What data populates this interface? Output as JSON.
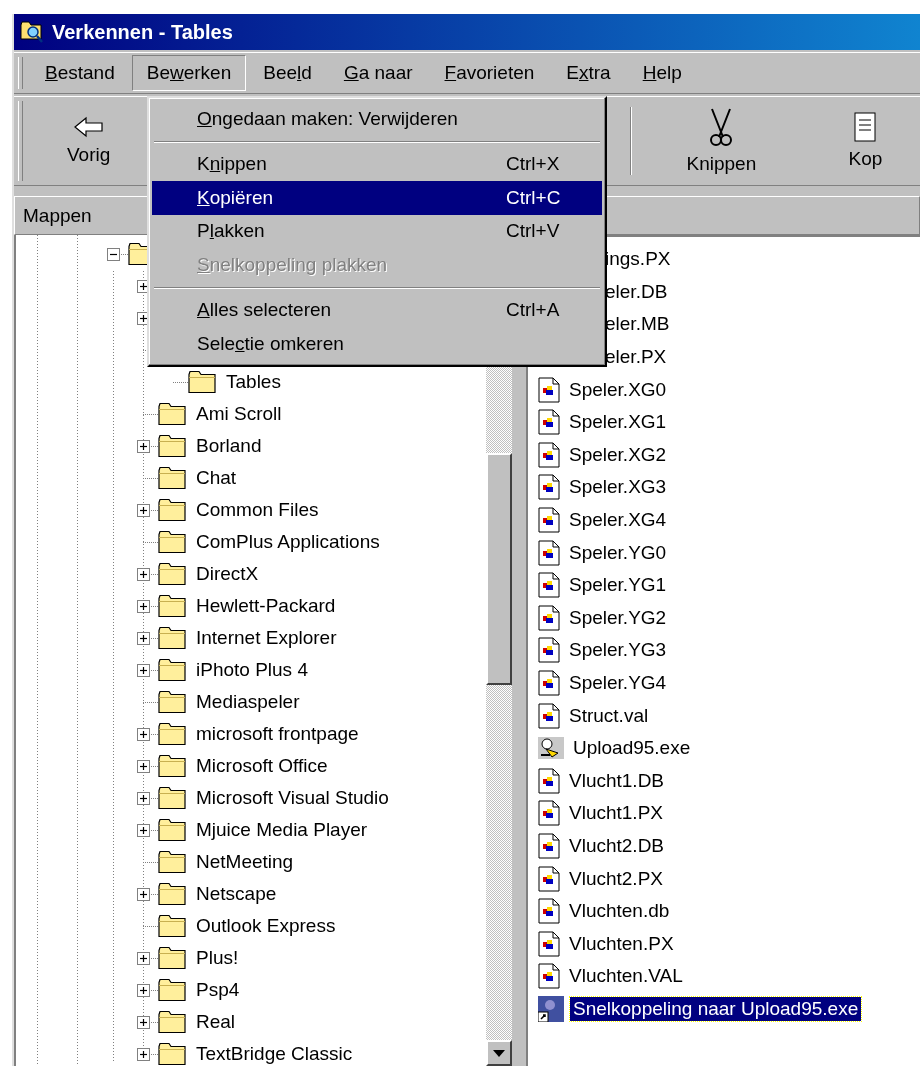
{
  "window": {
    "title": "Verkennen - Tables"
  },
  "menu_bar": [
    {
      "key": "B",
      "post": "estand",
      "selected": false
    },
    {
      "pre": "Be",
      "key": "w",
      "post": "erken",
      "selected": true
    },
    {
      "pre": "Bee",
      "key": "l",
      "post": "d",
      "selected": false
    },
    {
      "key": "G",
      "post": "a naar",
      "selected": false
    },
    {
      "key": "F",
      "post": "avorieten",
      "selected": false
    },
    {
      "pre": "E",
      "key": "x",
      "post": "tra",
      "selected": false
    },
    {
      "key": "H",
      "post": "elp",
      "selected": false
    }
  ],
  "toolbar": [
    {
      "kind": "back",
      "label": "Vorig"
    },
    {
      "kind": "separator"
    },
    {
      "kind": "cut",
      "label": "Knippen"
    },
    {
      "kind": "copy",
      "label": "Kop"
    }
  ],
  "edit_menu": [
    {
      "kind": "item",
      "key": "O",
      "post": "ngedaan maken:  Verwijderen",
      "disabled": false,
      "selected": false
    },
    {
      "kind": "separator"
    },
    {
      "kind": "item",
      "pre": "K",
      "key": "n",
      "post": "ippen",
      "shortcut": "Ctrl+X",
      "disabled": false,
      "selected": false
    },
    {
      "kind": "item",
      "key": "K",
      "post": "opiëren",
      "shortcut": "Ctrl+C",
      "disabled": false,
      "selected": true
    },
    {
      "kind": "item",
      "pre": "P",
      "key": "l",
      "post": "akken",
      "shortcut": "Ctrl+V",
      "disabled": false,
      "selected": false
    },
    {
      "kind": "item",
      "key": "S",
      "post": "nelkoppeling plakken",
      "disabled": true,
      "selected": false
    },
    {
      "kind": "separator"
    },
    {
      "kind": "item",
      "key": "A",
      "post": "lles selecteren",
      "shortcut": "Ctrl+A",
      "disabled": false,
      "selected": false
    },
    {
      "kind": "item",
      "pre": "Sele",
      "key": "c",
      "post": "tie omkeren",
      "disabled": false,
      "selected": false
    }
  ],
  "folders_pane": {
    "title": "Mappen"
  },
  "folder_tree": [
    {
      "expanded": true,
      "children": [
        {
          "expanded": false
        },
        {
          "expanded": false
        },
        {
          "children": [
            {
              "label": "Tables"
            }
          ]
        },
        {
          "label": "Ami Scroll"
        },
        {
          "label": "Borland",
          "expanded": false
        },
        {
          "label": "Chat"
        },
        {
          "label": "Common Files",
          "expanded": false
        },
        {
          "label": "ComPlus Applications"
        },
        {
          "label": "DirectX",
          "expanded": false
        },
        {
          "label": "Hewlett-Packard",
          "expanded": false
        },
        {
          "label": "Internet Explorer",
          "expanded": false
        },
        {
          "label": "iPhoto Plus 4",
          "expanded": false
        },
        {
          "label": "Mediaspeler"
        },
        {
          "label": "microsoft frontpage",
          "expanded": false
        },
        {
          "label": "Microsoft Office",
          "expanded": false
        },
        {
          "label": "Microsoft Visual Studio",
          "expanded": false
        },
        {
          "label": "Mjuice Media Player",
          "expanded": false
        },
        {
          "label": "NetMeeting"
        },
        {
          "label": "Netscape",
          "expanded": false
        },
        {
          "label": "Outlook Express"
        },
        {
          "label": "Plus!",
          "expanded": false
        },
        {
          "label": "Psp4",
          "expanded": false
        },
        {
          "label": "Real",
          "expanded": false
        },
        {
          "label": "TextBridge Classic",
          "expanded": false
        }
      ]
    }
  ],
  "files": [
    {
      "kind": "partial",
      "name": "ings.PX",
      "selected": false
    },
    {
      "kind": "partial",
      "name": "eler.DB",
      "selected": false
    },
    {
      "kind": "partial",
      "name": "eler.MB",
      "selected": false
    },
    {
      "kind": "partial",
      "name": "eler.PX",
      "selected": false
    },
    {
      "kind": "data",
      "name": "Speler.XG0",
      "selected": false
    },
    {
      "kind": "data",
      "name": "Speler.XG1",
      "selected": false
    },
    {
      "kind": "data",
      "name": "Speler.XG2",
      "selected": false
    },
    {
      "kind": "data",
      "name": "Speler.XG3",
      "selected": false
    },
    {
      "kind": "data",
      "name": "Speler.XG4",
      "selected": false
    },
    {
      "kind": "data",
      "name": "Speler.YG0",
      "selected": false
    },
    {
      "kind": "data",
      "name": "Speler.YG1",
      "selected": false
    },
    {
      "kind": "data",
      "name": "Speler.YG2",
      "selected": false
    },
    {
      "kind": "data",
      "name": "Speler.YG3",
      "selected": false
    },
    {
      "kind": "data",
      "name": "Speler.YG4",
      "selected": false
    },
    {
      "kind": "data",
      "name": "Struct.val",
      "selected": false
    },
    {
      "kind": "program",
      "name": "Upload95.exe",
      "selected": false
    },
    {
      "kind": "data",
      "name": "Vlucht1.DB",
      "selected": false
    },
    {
      "kind": "data",
      "name": "Vlucht1.PX",
      "selected": false
    },
    {
      "kind": "data",
      "name": "Vlucht2.DB",
      "selected": false
    },
    {
      "kind": "data",
      "name": "Vlucht2.PX",
      "selected": false
    },
    {
      "kind": "data",
      "name": "Vluchten.db",
      "selected": false
    },
    {
      "kind": "data",
      "name": "Vluchten.PX",
      "selected": false
    },
    {
      "kind": "data",
      "name": "Vluchten.VAL",
      "selected": false
    },
    {
      "kind": "shortcut",
      "name": "Snelkoppeling naar Upload95.exe",
      "selected": true
    }
  ]
}
